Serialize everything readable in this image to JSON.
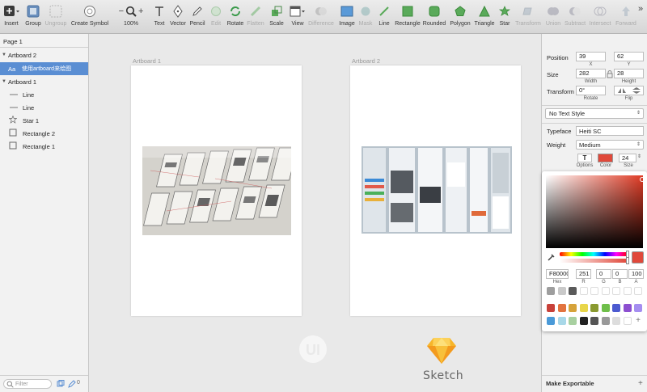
{
  "toolbar": {
    "insert": "Insert",
    "group": "Group",
    "ungroup": "Ungroup",
    "create_symbol": "Create Symbol",
    "zoom_minus": "−",
    "zoom_plus": "+",
    "zoom_level": "100%",
    "text": "Text",
    "vector": "Vector",
    "pencil": "Pencil",
    "edit": "Edit",
    "rotate": "Rotate",
    "flatten": "Flatten",
    "scale": "Scale",
    "view": "View",
    "difference": "Difference",
    "image": "Image",
    "mask": "Mask",
    "line": "Line",
    "rectangle": "Rectangle",
    "rounded": "Rounded",
    "polygon": "Polygon",
    "triangle": "Triangle",
    "star": "Star",
    "transform": "Transform",
    "union": "Union",
    "subtract": "Subtract",
    "intersect": "Intersect",
    "forward": "Forward",
    "more": "»"
  },
  "layers": {
    "page": "Page 1",
    "items": [
      {
        "label": "Artboard 2",
        "kind": "artboard"
      },
      {
        "label": "使用artboard来绘图",
        "kind": "text"
      },
      {
        "label": "Artboard 1",
        "kind": "artboard"
      },
      {
        "label": "Line",
        "kind": "line"
      },
      {
        "label": "Line",
        "kind": "line"
      },
      {
        "label": "Star 1",
        "kind": "star"
      },
      {
        "label": "Rectangle 2",
        "kind": "rect"
      },
      {
        "label": "Rectangle 1",
        "kind": "rect"
      }
    ],
    "text_glyph": "Aa",
    "filter_placeholder": "Filter",
    "badge_count": "0"
  },
  "canvas": {
    "artboard1_label": "Artboard 1",
    "artboard2_label": "Artboard 2",
    "sketch_label": "Sketch",
    "watermark": "UI"
  },
  "inspector": {
    "position_label": "Position",
    "x_value": "39",
    "y_value": "62",
    "x_label": "X",
    "y_label": "Y",
    "size_label": "Size",
    "width_value": "282",
    "height_value": "28",
    "width_label": "Width",
    "height_label": "Height",
    "transform_label": "Transform",
    "rotate_value": "0°",
    "rotate_label": "Rotate",
    "flip_label": "Flip",
    "text_style": "No Text Style",
    "typeface_label": "Typeface",
    "typeface_value": "Heiti SC",
    "weight_label": "Weight",
    "weight_value": "Medium",
    "options_label": "Options",
    "color_label": "Color",
    "size_label2": "Size",
    "font_size": "24",
    "make_exportable": "Make Exportable",
    "text_color": "#e0483a"
  },
  "picker": {
    "hex": "F80000",
    "r": "251",
    "g": "0",
    "b": "0",
    "a": "100",
    "hex_label": "Hex",
    "r_label": "R",
    "g_label": "G",
    "b_label": "B",
    "a_label": "A",
    "base_hue": "#e03c26",
    "current": "#e0483a",
    "swatch_rows": [
      [
        "#9e9e9e",
        "#c9c9c9",
        "#5a5a5a",
        "#ffffff",
        "#ffffff",
        "#ffffff",
        "#ffffff",
        "#ffffff",
        "#ffffff"
      ],
      [
        "#c8413a",
        "#e2733f",
        "#d6a33a",
        "#e8d64a",
        "#8a9a30",
        "#6fbf4a",
        "#4c5ad0",
        "#8c4fd0",
        "#a58ef0"
      ],
      [
        "#4a9ad8",
        "#a8d8e8",
        "#a8d0a0",
        "#222222",
        "#555555",
        "#999999",
        "#dddddd",
        "#ffffff",
        "plus"
      ]
    ]
  }
}
